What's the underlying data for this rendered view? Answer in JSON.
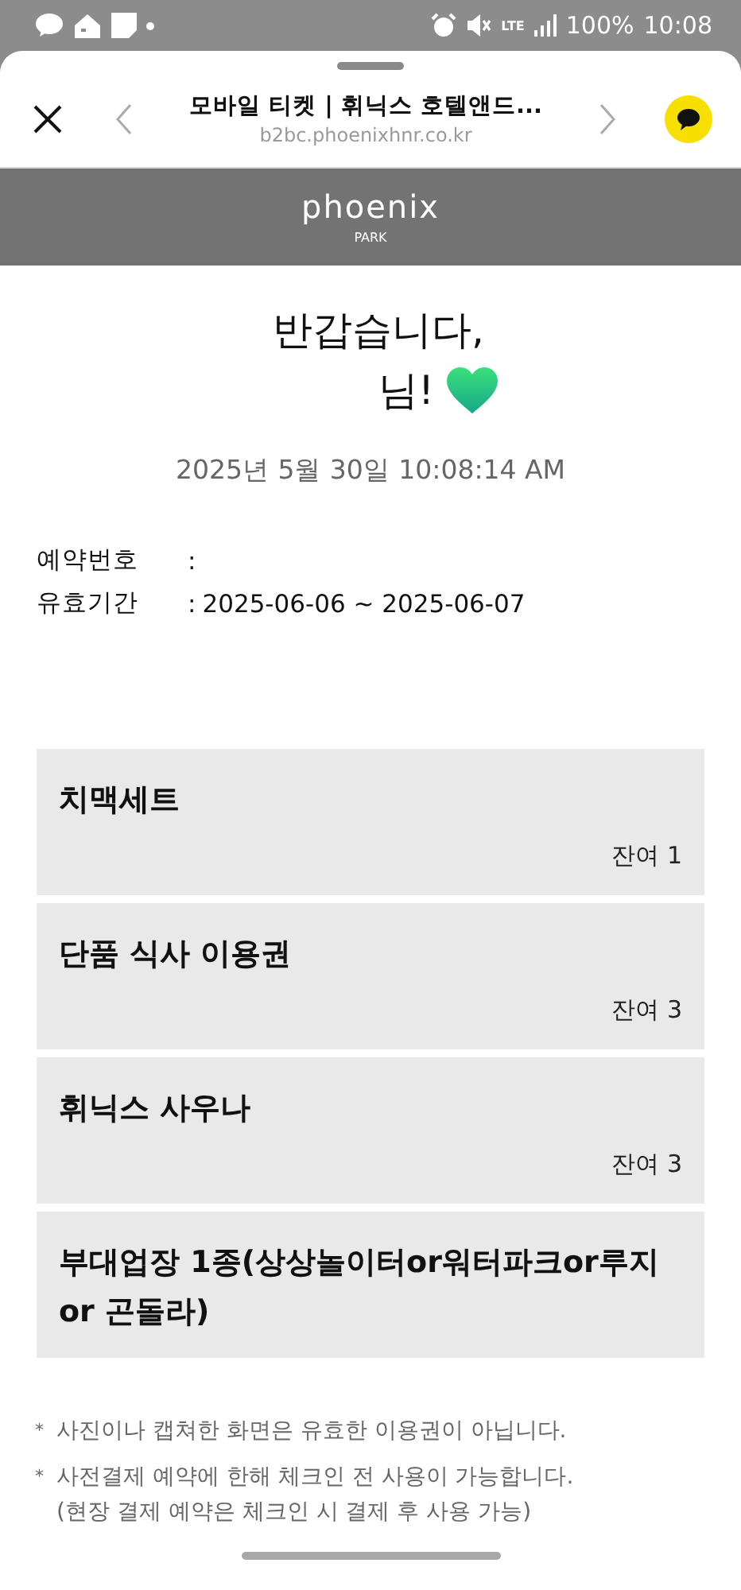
{
  "status_bar": {
    "network": "LTE",
    "battery": "100%",
    "time": "10:08"
  },
  "browser": {
    "title": "모바일 티켓 | 휘닉스 호텔앤드...",
    "url": "b2bc.phoenixhnr.co.kr"
  },
  "brand": {
    "logo": "phoenix",
    "sub": "PARK"
  },
  "greeting": {
    "line1": "반갑습니다,",
    "line2": "님!"
  },
  "datetime": "2025년 5월 30일 10:08:14 AM",
  "info": [
    {
      "label": "예약번호",
      "separator": ":"
    },
    {
      "label": "유효기간",
      "separator": ":",
      "value": "2025-06-06 ~ 2025-06-07"
    }
  ],
  "tickets": [
    {
      "name": "치맥세트",
      "remaining": "잔여 1"
    },
    {
      "name": "단품 식사 이용권",
      "remaining": "잔여 3"
    },
    {
      "name": "휘닉스 사우나",
      "remaining": "잔여 3"
    },
    {
      "name": "부대업장 1종(상상놀이터or워터파크or루지or 곤돌라)"
    }
  ],
  "notes": [
    {
      "marker": "*",
      "text": "사진이나 캡쳐한 화면은 유효한 이용권이 아닙니다."
    },
    {
      "marker": "*",
      "text": "사전결제 예약에 한해 체크인 전 사용이 가능합니다.\n(현장 결제 예약은 체크인 시 결제 후 사용 가능)"
    }
  ]
}
